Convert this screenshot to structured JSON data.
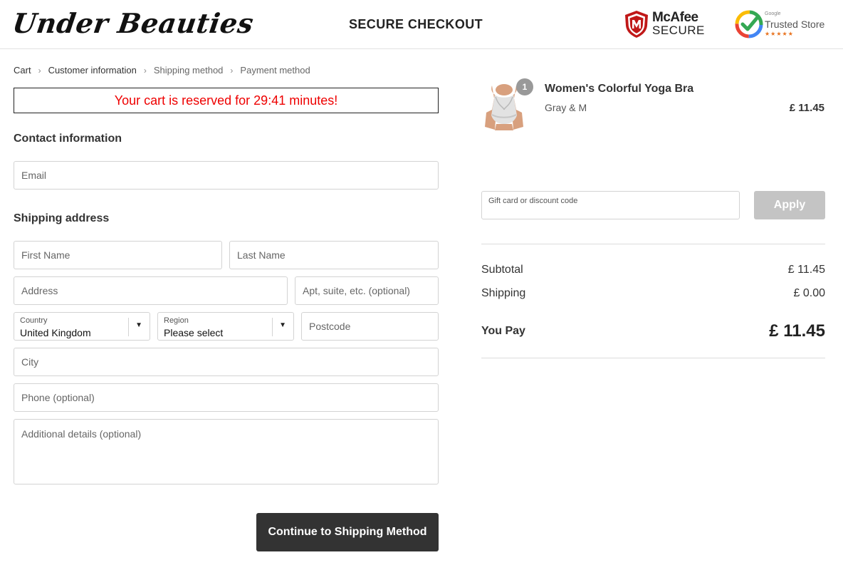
{
  "header": {
    "logo": "Under Beauties",
    "title": "SECURE CHECKOUT",
    "mcafee_brand": "McAfee",
    "mcafee_secure": "SECURE",
    "trusted_google": "Google",
    "trusted_label": "Trusted Store",
    "trusted_stars": "★★★★★"
  },
  "breadcrumb": {
    "items": [
      "Cart",
      "Customer information",
      "Shipping method",
      "Payment method"
    ],
    "separator": "›"
  },
  "reservation": "Your cart is reserved for 29:41 minutes!",
  "contact": {
    "title": "Contact information",
    "email_placeholder": "Email"
  },
  "shipping": {
    "title": "Shipping address",
    "first_name_placeholder": "First Name",
    "last_name_placeholder": "Last Name",
    "address_placeholder": "Address",
    "apt_placeholder": "Apt, suite, etc. (optional)",
    "country_label": "Country",
    "country_value": "United Kingdom",
    "region_label": "Region",
    "region_value": "Please select",
    "postcode_placeholder": "Postcode",
    "city_placeholder": "City",
    "phone_placeholder": "Phone (optional)",
    "details_placeholder": "Additional details (optional)"
  },
  "continue_label": "Continue to Shipping Method",
  "order": {
    "quantity": "1",
    "product_name": "Women's Colorful Yoga Bra",
    "variant": "Gray & M",
    "price": "£ 11.45",
    "gift_placeholder": "Gift card or discount code",
    "apply_label": "Apply",
    "subtotal_label": "Subtotal",
    "subtotal_value": "£ 11.45",
    "shipping_label": "Shipping",
    "shipping_value": "£ 0.00",
    "pay_label": "You Pay",
    "pay_value": "£ 11.45"
  },
  "colors": {
    "reservation_text": "#e00000",
    "continue_button": "#333333",
    "apply_button": "#c4c4c4",
    "mcafee_red": "#c01818"
  },
  "icons": {
    "mcafee": "mcafee-shield-icon",
    "trusted": "google-trusted-check-icon",
    "select_arrow": "caret-down-icon"
  }
}
